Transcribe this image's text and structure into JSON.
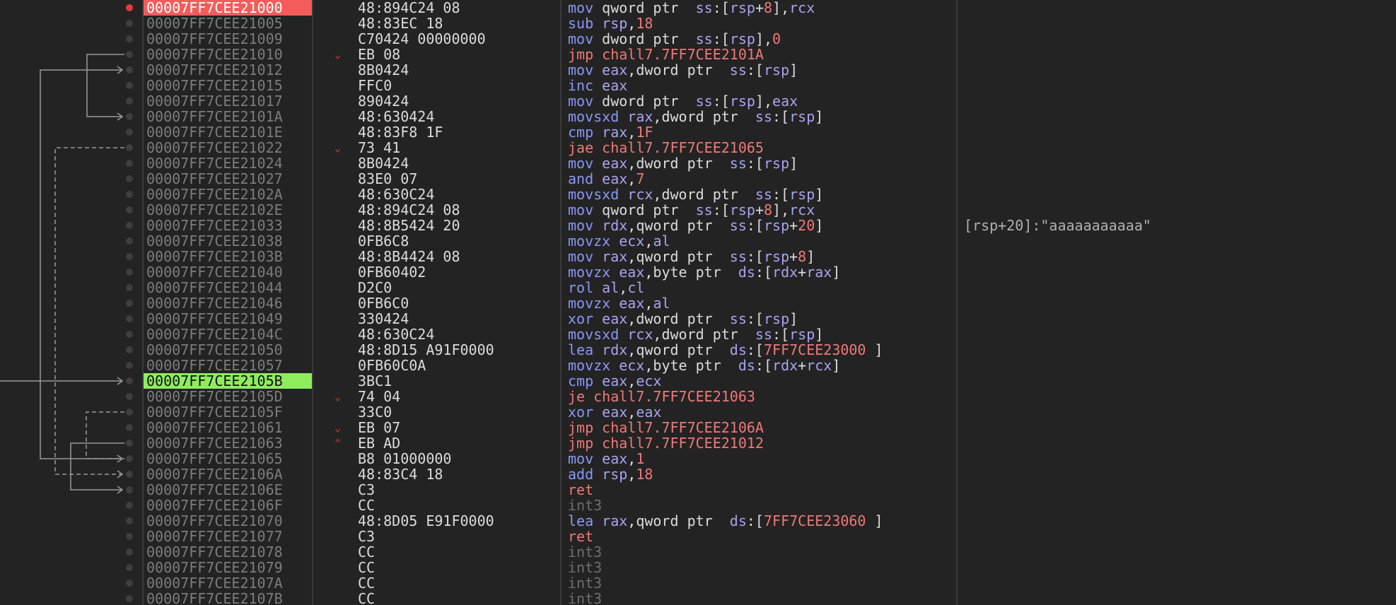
{
  "colors": {
    "background": "#232323",
    "breakpoint": "#e33a3a",
    "current_highlight": "#8eed5d",
    "breakpoint_highlight": "#f45b5b",
    "address_text": "#7c7c7c",
    "mnemonic": "#8a97f5",
    "register": "#a8a4f0",
    "immediate": "#f07878",
    "arrow": "#9a9a9a"
  },
  "rows": [
    {
      "addr": "00007FF7CEE21000",
      "bytes": "48:894C24 08",
      "bp": true,
      "hl": "red",
      "jm": "",
      "instr": [
        [
          "mov",
          "mn"
        ],
        [
          " qword ptr  ",
          "kw"
        ],
        [
          "ss",
          "seg"
        ],
        [
          ":[",
          "pun"
        ],
        [
          "rsp",
          "reg"
        ],
        [
          "+",
          "pun"
        ],
        [
          "8",
          "imm"
        ],
        [
          "],",
          "pun"
        ],
        [
          "rcx",
          "reg"
        ]
      ],
      "comment": ""
    },
    {
      "addr": "00007FF7CEE21005",
      "bytes": "48:83EC 18",
      "bp": false,
      "hl": "",
      "jm": "",
      "instr": [
        [
          "sub",
          "mn"
        ],
        [
          " ",
          "pun"
        ],
        [
          "rsp",
          "reg"
        ],
        [
          ",",
          "pun"
        ],
        [
          "18",
          "imm"
        ]
      ],
      "comment": ""
    },
    {
      "addr": "00007FF7CEE21009",
      "bytes": "C70424 00000000",
      "bp": false,
      "hl": "",
      "jm": "",
      "instr": [
        [
          "mov",
          "mn"
        ],
        [
          " dword ptr  ",
          "kw"
        ],
        [
          "ss",
          "seg"
        ],
        [
          ":[",
          "pun"
        ],
        [
          "rsp",
          "reg"
        ],
        [
          "],",
          "pun"
        ],
        [
          "0",
          "imm"
        ]
      ],
      "comment": ""
    },
    {
      "addr": "00007FF7CEE21010",
      "bytes": "EB 08",
      "bp": false,
      "hl": "",
      "jm": "v",
      "instr": [
        [
          "jmp chall7.7FF7CEE2101A",
          "jmp"
        ]
      ],
      "comment": ""
    },
    {
      "addr": "00007FF7CEE21012",
      "bytes": "8B0424",
      "bp": false,
      "hl": "",
      "jm": "",
      "instr": [
        [
          "mov",
          "mn"
        ],
        [
          " ",
          "pun"
        ],
        [
          "eax",
          "reg"
        ],
        [
          ",dword ptr  ",
          "kw"
        ],
        [
          "ss",
          "seg"
        ],
        [
          ":[",
          "pun"
        ],
        [
          "rsp",
          "reg"
        ],
        [
          "]",
          "pun"
        ]
      ],
      "comment": ""
    },
    {
      "addr": "00007FF7CEE21015",
      "bytes": "FFC0",
      "bp": false,
      "hl": "",
      "jm": "",
      "instr": [
        [
          "inc",
          "mn"
        ],
        [
          " ",
          "pun"
        ],
        [
          "eax",
          "reg"
        ]
      ],
      "comment": ""
    },
    {
      "addr": "00007FF7CEE21017",
      "bytes": "890424",
      "bp": false,
      "hl": "",
      "jm": "",
      "instr": [
        [
          "mov",
          "mn"
        ],
        [
          " dword ptr  ",
          "kw"
        ],
        [
          "ss",
          "seg"
        ],
        [
          ":[",
          "pun"
        ],
        [
          "rsp",
          "reg"
        ],
        [
          "],",
          "pun"
        ],
        [
          "eax",
          "reg"
        ]
      ],
      "comment": ""
    },
    {
      "addr": "00007FF7CEE2101A",
      "bytes": "48:630424",
      "bp": false,
      "hl": "",
      "jm": "",
      "instr": [
        [
          "movsxd",
          "mn"
        ],
        [
          " ",
          "pun"
        ],
        [
          "rax",
          "reg"
        ],
        [
          ",dword ptr  ",
          "kw"
        ],
        [
          "ss",
          "seg"
        ],
        [
          ":[",
          "pun"
        ],
        [
          "rsp",
          "reg"
        ],
        [
          "]",
          "pun"
        ]
      ],
      "comment": ""
    },
    {
      "addr": "00007FF7CEE2101E",
      "bytes": "48:83F8 1F",
      "bp": false,
      "hl": "",
      "jm": "",
      "instr": [
        [
          "cmp",
          "mn"
        ],
        [
          " ",
          "pun"
        ],
        [
          "rax",
          "reg"
        ],
        [
          ",",
          "pun"
        ],
        [
          "1F",
          "imm"
        ]
      ],
      "comment": ""
    },
    {
      "addr": "00007FF7CEE21022",
      "bytes": "73 41",
      "bp": false,
      "hl": "",
      "jm": "v",
      "instr": [
        [
          "jae chall7.7FF7CEE21065",
          "jmp"
        ]
      ],
      "comment": ""
    },
    {
      "addr": "00007FF7CEE21024",
      "bytes": "8B0424",
      "bp": false,
      "hl": "",
      "jm": "",
      "instr": [
        [
          "mov",
          "mn"
        ],
        [
          " ",
          "pun"
        ],
        [
          "eax",
          "reg"
        ],
        [
          ",dword ptr  ",
          "kw"
        ],
        [
          "ss",
          "seg"
        ],
        [
          ":[",
          "pun"
        ],
        [
          "rsp",
          "reg"
        ],
        [
          "]",
          "pun"
        ]
      ],
      "comment": ""
    },
    {
      "addr": "00007FF7CEE21027",
      "bytes": "83E0 07",
      "bp": false,
      "hl": "",
      "jm": "",
      "instr": [
        [
          "and",
          "mn"
        ],
        [
          " ",
          "pun"
        ],
        [
          "eax",
          "reg"
        ],
        [
          ",",
          "pun"
        ],
        [
          "7",
          "imm"
        ]
      ],
      "comment": ""
    },
    {
      "addr": "00007FF7CEE2102A",
      "bytes": "48:630C24",
      "bp": false,
      "hl": "",
      "jm": "",
      "instr": [
        [
          "movsxd",
          "mn"
        ],
        [
          " ",
          "pun"
        ],
        [
          "rcx",
          "reg"
        ],
        [
          ",dword ptr  ",
          "kw"
        ],
        [
          "ss",
          "seg"
        ],
        [
          ":[",
          "pun"
        ],
        [
          "rsp",
          "reg"
        ],
        [
          "]",
          "pun"
        ]
      ],
      "comment": ""
    },
    {
      "addr": "00007FF7CEE2102E",
      "bytes": "48:894C24 08",
      "bp": false,
      "hl": "",
      "jm": "",
      "instr": [
        [
          "mov",
          "mn"
        ],
        [
          " qword ptr  ",
          "kw"
        ],
        [
          "ss",
          "seg"
        ],
        [
          ":[",
          "pun"
        ],
        [
          "rsp",
          "reg"
        ],
        [
          "+",
          "pun"
        ],
        [
          "8",
          "imm"
        ],
        [
          "],",
          "pun"
        ],
        [
          "rcx",
          "reg"
        ]
      ],
      "comment": ""
    },
    {
      "addr": "00007FF7CEE21033",
      "bytes": "48:8B5424 20",
      "bp": false,
      "hl": "",
      "jm": "",
      "instr": [
        [
          "mov",
          "mn"
        ],
        [
          " ",
          "pun"
        ],
        [
          "rdx",
          "reg"
        ],
        [
          ",qword ptr  ",
          "kw"
        ],
        [
          "ss",
          "seg"
        ],
        [
          ":[",
          "pun"
        ],
        [
          "rsp",
          "reg"
        ],
        [
          "+",
          "pun"
        ],
        [
          "20",
          "imm"
        ],
        [
          "]",
          "pun"
        ]
      ],
      "comment": "[rsp+20]:\"aaaaaaaaaaa\""
    },
    {
      "addr": "00007FF7CEE21038",
      "bytes": "0FB6C8",
      "bp": false,
      "hl": "",
      "jm": "",
      "instr": [
        [
          "movzx",
          "mn"
        ],
        [
          " ",
          "pun"
        ],
        [
          "ecx",
          "reg"
        ],
        [
          ",",
          "pun"
        ],
        [
          "al",
          "reg"
        ]
      ],
      "comment": ""
    },
    {
      "addr": "00007FF7CEE2103B",
      "bytes": "48:8B4424 08",
      "bp": false,
      "hl": "",
      "jm": "",
      "instr": [
        [
          "mov",
          "mn"
        ],
        [
          " ",
          "pun"
        ],
        [
          "rax",
          "reg"
        ],
        [
          ",qword ptr  ",
          "kw"
        ],
        [
          "ss",
          "seg"
        ],
        [
          ":[",
          "pun"
        ],
        [
          "rsp",
          "reg"
        ],
        [
          "+",
          "pun"
        ],
        [
          "8",
          "imm"
        ],
        [
          "]",
          "pun"
        ]
      ],
      "comment": ""
    },
    {
      "addr": "00007FF7CEE21040",
      "bytes": "0FB60402",
      "bp": false,
      "hl": "",
      "jm": "",
      "instr": [
        [
          "movzx",
          "mn"
        ],
        [
          " ",
          "pun"
        ],
        [
          "eax",
          "reg"
        ],
        [
          ",byte ptr  ",
          "kw"
        ],
        [
          "ds",
          "seg"
        ],
        [
          ":[",
          "pun"
        ],
        [
          "rdx",
          "reg"
        ],
        [
          "+",
          "pun"
        ],
        [
          "rax",
          "reg"
        ],
        [
          "]",
          "pun"
        ]
      ],
      "comment": ""
    },
    {
      "addr": "00007FF7CEE21044",
      "bytes": "D2C0",
      "bp": false,
      "hl": "",
      "jm": "",
      "instr": [
        [
          "rol",
          "mn"
        ],
        [
          " ",
          "pun"
        ],
        [
          "al",
          "reg"
        ],
        [
          ",",
          "pun"
        ],
        [
          "cl",
          "reg"
        ]
      ],
      "comment": ""
    },
    {
      "addr": "00007FF7CEE21046",
      "bytes": "0FB6C0",
      "bp": false,
      "hl": "",
      "jm": "",
      "instr": [
        [
          "movzx",
          "mn"
        ],
        [
          " ",
          "pun"
        ],
        [
          "eax",
          "reg"
        ],
        [
          ",",
          "pun"
        ],
        [
          "al",
          "reg"
        ]
      ],
      "comment": ""
    },
    {
      "addr": "00007FF7CEE21049",
      "bytes": "330424",
      "bp": false,
      "hl": "",
      "jm": "",
      "instr": [
        [
          "xor",
          "mn"
        ],
        [
          " ",
          "pun"
        ],
        [
          "eax",
          "reg"
        ],
        [
          ",dword ptr  ",
          "kw"
        ],
        [
          "ss",
          "seg"
        ],
        [
          ":[",
          "pun"
        ],
        [
          "rsp",
          "reg"
        ],
        [
          "]",
          "pun"
        ]
      ],
      "comment": ""
    },
    {
      "addr": "00007FF7CEE2104C",
      "bytes": "48:630C24",
      "bp": false,
      "hl": "",
      "jm": "",
      "instr": [
        [
          "movsxd",
          "mn"
        ],
        [
          " ",
          "pun"
        ],
        [
          "rcx",
          "reg"
        ],
        [
          ",dword ptr  ",
          "kw"
        ],
        [
          "ss",
          "seg"
        ],
        [
          ":[",
          "pun"
        ],
        [
          "rsp",
          "reg"
        ],
        [
          "]",
          "pun"
        ]
      ],
      "comment": ""
    },
    {
      "addr": "00007FF7CEE21050",
      "bytes": "48:8D15 A91F0000",
      "bp": false,
      "hl": "",
      "jm": "",
      "instr": [
        [
          "lea",
          "mn"
        ],
        [
          " ",
          "pun"
        ],
        [
          "rdx",
          "reg"
        ],
        [
          ",qword ptr  ",
          "kw"
        ],
        [
          "ds",
          "seg"
        ],
        [
          ":[",
          "pun"
        ],
        [
          "7FF7CEE23000",
          "sym"
        ],
        [
          " ]",
          "pun"
        ]
      ],
      "comment": ""
    },
    {
      "addr": "00007FF7CEE21057",
      "bytes": "0FB60C0A",
      "bp": false,
      "hl": "",
      "jm": "",
      "instr": [
        [
          "movzx",
          "mn"
        ],
        [
          " ",
          "pun"
        ],
        [
          "ecx",
          "reg"
        ],
        [
          ",byte ptr  ",
          "kw"
        ],
        [
          "ds",
          "seg"
        ],
        [
          ":[",
          "pun"
        ],
        [
          "rdx",
          "reg"
        ],
        [
          "+",
          "pun"
        ],
        [
          "rcx",
          "reg"
        ],
        [
          "]",
          "pun"
        ]
      ],
      "comment": ""
    },
    {
      "addr": "00007FF7CEE2105B",
      "bytes": "3BC1",
      "bp": false,
      "hl": "green",
      "jm": "",
      "instr": [
        [
          "cmp",
          "mn"
        ],
        [
          " ",
          "pun"
        ],
        [
          "eax",
          "reg"
        ],
        [
          ",",
          "pun"
        ],
        [
          "ecx",
          "reg"
        ]
      ],
      "comment": ""
    },
    {
      "addr": "00007FF7CEE2105D",
      "bytes": "74 04",
      "bp": false,
      "hl": "",
      "jm": "v",
      "instr": [
        [
          "je chall7.7FF7CEE21063",
          "jmp"
        ]
      ],
      "comment": ""
    },
    {
      "addr": "00007FF7CEE2105F",
      "bytes": "33C0",
      "bp": false,
      "hl": "",
      "jm": "",
      "instr": [
        [
          "xor",
          "mn"
        ],
        [
          " ",
          "pun"
        ],
        [
          "eax",
          "reg"
        ],
        [
          ",",
          "pun"
        ],
        [
          "eax",
          "reg"
        ]
      ],
      "comment": ""
    },
    {
      "addr": "00007FF7CEE21061",
      "bytes": "EB 07",
      "bp": false,
      "hl": "",
      "jm": "v",
      "instr": [
        [
          "jmp chall7.7FF7CEE2106A",
          "jmp"
        ]
      ],
      "comment": ""
    },
    {
      "addr": "00007FF7CEE21063",
      "bytes": "EB AD",
      "bp": false,
      "hl": "",
      "jm": "^",
      "instr": [
        [
          "jmp chall7.7FF7CEE21012",
          "jmp"
        ]
      ],
      "comment": ""
    },
    {
      "addr": "00007FF7CEE21065",
      "bytes": "B8 01000000",
      "bp": false,
      "hl": "",
      "jm": "",
      "instr": [
        [
          "mov",
          "mn"
        ],
        [
          " ",
          "pun"
        ],
        [
          "eax",
          "reg"
        ],
        [
          ",",
          "pun"
        ],
        [
          "1",
          "imm"
        ]
      ],
      "comment": ""
    },
    {
      "addr": "00007FF7CEE2106A",
      "bytes": "48:83C4 18",
      "bp": false,
      "hl": "",
      "jm": "",
      "instr": [
        [
          "add",
          "mn"
        ],
        [
          " ",
          "pun"
        ],
        [
          "rsp",
          "reg"
        ],
        [
          ",",
          "pun"
        ],
        [
          "18",
          "imm"
        ]
      ],
      "comment": ""
    },
    {
      "addr": "00007FF7CEE2106E",
      "bytes": "C3",
      "bp": false,
      "hl": "",
      "jm": "",
      "instr": [
        [
          "ret",
          "ret"
        ]
      ],
      "comment": ""
    },
    {
      "addr": "00007FF7CEE2106F",
      "bytes": "CC",
      "bp": false,
      "hl": "",
      "jm": "",
      "instr": [
        [
          "int3",
          "nop"
        ]
      ],
      "comment": ""
    },
    {
      "addr": "00007FF7CEE21070",
      "bytes": "48:8D05 E91F0000",
      "bp": false,
      "hl": "",
      "jm": "",
      "instr": [
        [
          "lea",
          "mn"
        ],
        [
          " ",
          "pun"
        ],
        [
          "rax",
          "reg"
        ],
        [
          ",qword ptr  ",
          "kw"
        ],
        [
          "ds",
          "seg"
        ],
        [
          ":[",
          "pun"
        ],
        [
          "7FF7CEE23060",
          "sym"
        ],
        [
          " ]",
          "pun"
        ]
      ],
      "comment": ""
    },
    {
      "addr": "00007FF7CEE21077",
      "bytes": "C3",
      "bp": false,
      "hl": "",
      "jm": "",
      "instr": [
        [
          "ret",
          "ret"
        ]
      ],
      "comment": ""
    },
    {
      "addr": "00007FF7CEE21078",
      "bytes": "CC",
      "bp": false,
      "hl": "",
      "jm": "",
      "instr": [
        [
          "int3",
          "nop"
        ]
      ],
      "comment": ""
    },
    {
      "addr": "00007FF7CEE21079",
      "bytes": "CC",
      "bp": false,
      "hl": "",
      "jm": "",
      "instr": [
        [
          "int3",
          "nop"
        ]
      ],
      "comment": ""
    },
    {
      "addr": "00007FF7CEE2107A",
      "bytes": "CC",
      "bp": false,
      "hl": "",
      "jm": "",
      "instr": [
        [
          "int3",
          "nop"
        ]
      ],
      "comment": ""
    },
    {
      "addr": "00007FF7CEE2107B",
      "bytes": "CC",
      "bp": false,
      "hl": "",
      "jm": "",
      "instr": [
        [
          "int3",
          "nop"
        ]
      ],
      "comment": ""
    }
  ],
  "arrows": [
    {
      "from": 3,
      "to": 7,
      "dashed": false
    },
    {
      "from": 28,
      "to": 31,
      "dashed": false
    },
    {
      "from": 29,
      "to": 4,
      "dashed": false
    },
    {
      "from": 9,
      "to": 30,
      "dashed": true
    },
    {
      "from": 26,
      "to": 29,
      "dashed": true
    }
  ]
}
